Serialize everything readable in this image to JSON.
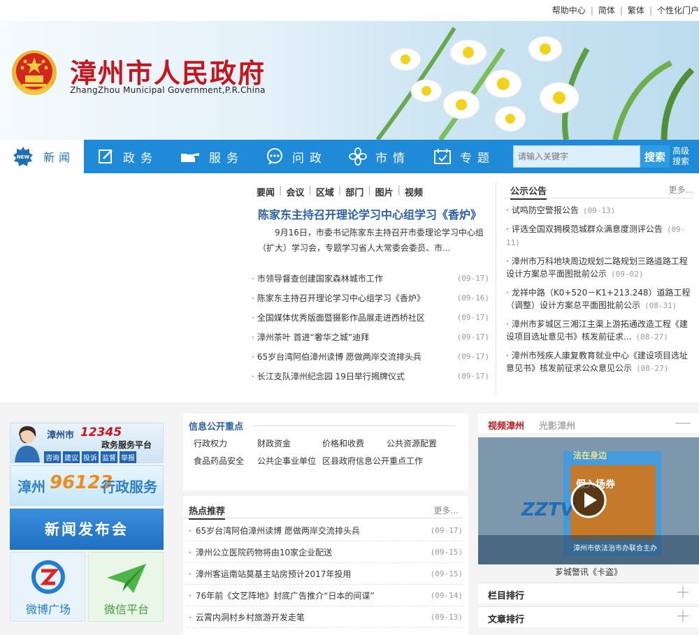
{
  "top_links": [
    "帮助中心",
    "简体",
    "繁体",
    "个性化门户"
  ],
  "header": {
    "title": "漳州市人民政府",
    "subtitle": "ZhangZhou Municipal Government,P.R.China"
  },
  "nav": {
    "news_badge": "NEW",
    "items": [
      "新闻",
      "政务",
      "服务",
      "问政",
      "市情",
      "专题"
    ],
    "search_placeholder": "请输入关键字",
    "search_button": "搜索",
    "advanced_search": "高级搜索"
  },
  "news": {
    "tabs": [
      "要闻",
      "会议",
      "区域",
      "部门",
      "图片",
      "视频"
    ],
    "headline": "陈家东主持召开理论学习中心组学习《香炉》",
    "summary": "9月16日，市委书记陈家东主持召开市委理论学习中心组（扩大）学习会，专题学习省人大常委会委员、市...",
    "items": [
      {
        "title": "市领导督查创建国家森林城市工作",
        "date": "(09-17)"
      },
      {
        "title": "陈家东主持召开理论学习中心组学习《香炉》",
        "date": "(09-16)"
      },
      {
        "title": "全国媒体优秀版面暨摄影作品展走进西桥社区",
        "date": "(09-17)"
      },
      {
        "title": "漳州茶叶 首进“奢华之城”迪拜",
        "date": "(09-17)"
      },
      {
        "title": "65岁台湾阿伯漳州读博 愿做两岸交流排头兵",
        "date": "(09-17)"
      },
      {
        "title": "长江支队漳州纪念园 19日举行揭牌仪式",
        "date": "(09-17)"
      }
    ]
  },
  "notices": {
    "title": "公示公告",
    "more": "更多...",
    "items": [
      {
        "title": "试鸣防空警报公告",
        "date": "(09-13)"
      },
      {
        "title": "评选全国双拥模范城群众满意度测评公告",
        "date": "(09-11)"
      },
      {
        "title": "漳州市万科地块周边规划二路规划三路道路工程设计方案总平面图批前公示",
        "date": "(09-02)"
      },
      {
        "title": "龙祥中路（K0+520－K1+213.248）道路工程（调整）设计方案总平面图批前公示",
        "date": "(08-31)"
      },
      {
        "title": "漳州市芗城区三湘江主渠上游拓通改造工程《建设项目选址意见书》核发前征求...",
        "date": "(08-27)"
      },
      {
        "title": "漳州市残疾人康复教育就业中心《建设项目选址意见书》核发前征求公众意见公示",
        "date": "(08-27)"
      }
    ]
  },
  "side_banners": {
    "b12345_city": "漳州市",
    "b12345_num": "12345",
    "b12345_sub": "政务服务平台",
    "b12345_tags": [
      "咨询",
      "建议",
      "投诉",
      "监督",
      "举报"
    ],
    "b96123_city": "漳州",
    "b96123_num": "96123",
    "b96123_text": "行政服务",
    "press": "新闻发布会",
    "weibo": "微博广场",
    "wechat": "微信平台"
  },
  "info_public": {
    "title": "信息公开重点",
    "links": [
      "行政权力",
      "财政资金",
      "价格和收费",
      "公共资源配置",
      "食品药品安全",
      "公共企事业单位",
      "区县政府信息公开重点工作"
    ]
  },
  "hot": {
    "title": "热点推荐",
    "more": "更多...",
    "items": [
      {
        "title": "65岁台湾阿伯漳州读博 愿做两岸交流排头兵",
        "date": "(09-17)"
      },
      {
        "title": "漳州公立医院药物将由10家企业配送",
        "date": "(09-15)"
      },
      {
        "title": "漳州客运南站莫基主站房预计2017年投用",
        "date": "(09-15)"
      },
      {
        "title": "76年前《文艺阵地》封底广告推介“日本的间谍”",
        "date": "(09-14)"
      },
      {
        "title": "云霄内洞村乡村旅游开发走笔",
        "date": "(09-13)"
      }
    ]
  },
  "video": {
    "tab_active": "视频漳州",
    "tab_inactive": "光影漳州",
    "logo": "ZZTV",
    "top_text": "法在身边",
    "inner_text": "假入场券",
    "bottom_text": "漳州市依法治市办联合主办",
    "caption": "芗城警讯《卡盗》"
  },
  "rankings": [
    "栏目排行",
    "文章排行"
  ],
  "colors": {
    "brand_red": "#c4161c",
    "nav_blue": "#1e8ad8",
    "link_blue": "#2b5fa6"
  }
}
